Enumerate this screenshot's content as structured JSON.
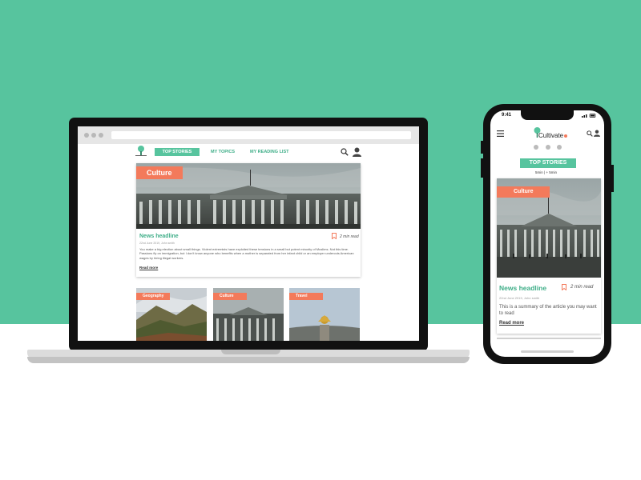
{
  "colors": {
    "background": "#57c49e",
    "accent": "#57c49e",
    "accent_text": "#3fae88",
    "tag": "#f37a5b"
  },
  "desktop": {
    "nav": {
      "logo_icon": "tree-icon",
      "top_stories": "TOP STORIES",
      "my_topics": "MY TOPICS",
      "my_reading_list": "MY READING LIST",
      "search_icon": "search-icon",
      "user_icon": "user-icon"
    },
    "featured": {
      "tag": "Culture",
      "headline": "News headline",
      "bookmark_icon": "bookmark-icon",
      "read_time": "2 min read",
      "meta": "22nd June 2019, John smith",
      "summary": "You make a big election about small things. Violent extremists have exploited these tensions in a small but potent minority of Muslims. Not this time. Passions fly on immigration, but I don't know anyone who benefits when a mother is separated from her infant child or an employer undercuts American wages by hiring illegal workers.",
      "read_more": "Read more"
    },
    "cards": [
      {
        "tag": "Geography"
      },
      {
        "tag": "Culture"
      },
      {
        "tag": "Travel"
      }
    ]
  },
  "mobile": {
    "status_time": "9:41",
    "menu_icon": "hamburger-menu-icon",
    "brand": "Cultivate",
    "carousel_dots": 3,
    "tab": "TOP STORIES",
    "filter": "5min | + 5min",
    "card": {
      "tag": "Culture",
      "headline": "News headline",
      "bookmark_icon": "bookmark-icon",
      "read_time": "2 min read",
      "meta": "22nd June 2019, John smith",
      "summary": "This is a summary of the article you may want to read",
      "read_more": "Read more"
    }
  }
}
